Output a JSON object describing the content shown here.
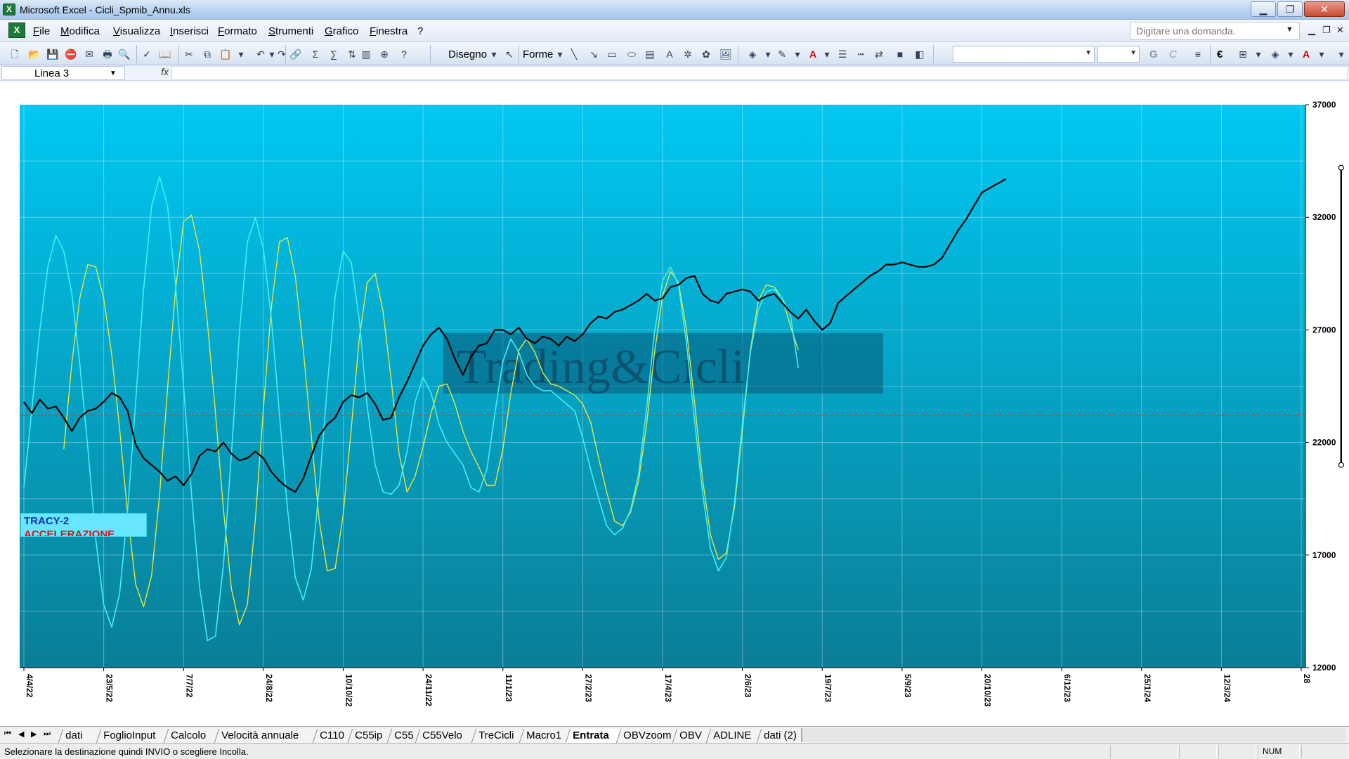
{
  "window": {
    "title": "Microsoft Excel - Cicli_Spmib_Annu.xls"
  },
  "menu": {
    "items": [
      "File",
      "Modifica",
      "Visualizza",
      "Inserisci",
      "Formato",
      "Strumenti",
      "Grafico",
      "Finestra",
      "?"
    ],
    "help_placeholder": "Digitare una domanda."
  },
  "toolbar": {
    "drawing_label": "Disegno",
    "shapes_label": "Forme",
    "font_bold": "G",
    "font_italic": "C",
    "currency_symbol": "€"
  },
  "formula_bar": {
    "name_box": "Linea 3",
    "fx": "fx"
  },
  "chart_data": {
    "type": "line",
    "watermark": "Trading&Cicli",
    "legend_title": "TRACY-2",
    "legend_subtitle": "ACCELERAZIONE",
    "y_ticks": [
      37000,
      32000,
      27000,
      22000,
      17000,
      12000
    ],
    "ylim": [
      12000,
      37000
    ],
    "x_tick_labels": [
      "4/4/22",
      "23/5/22",
      "7/7/22",
      "24/8/22",
      "10/10/22",
      "24/11/22",
      "11/1/23",
      "27/2/23",
      "17/4/23",
      "2/6/23",
      "19/7/23",
      "5/9/23",
      "20/10/23",
      "6/12/23",
      "25/1/24",
      "12/3/24",
      "28"
    ],
    "reference_level": 23200,
    "vertical_marker": {
      "x_index": 165,
      "y_top": 34200,
      "y_bottom": 21000
    },
    "colors": {
      "price": "#000000",
      "fast_cycle": "#3ff0f0",
      "slow_cycle": "#e8e83a",
      "reference": "#ff3030",
      "background_top": "#00c8f2",
      "background_bottom": "#0a7e96"
    },
    "points_per_tick": 10,
    "series": [
      {
        "x_start": 0,
        "values": [
          23800,
          23300,
          23900,
          23500,
          23600,
          23100,
          22500,
          23100,
          23400,
          23500,
          23800,
          24200,
          24000,
          23400,
          21900,
          21300,
          21000,
          20700,
          20300,
          20500,
          20100,
          20600,
          21400,
          21700,
          21600,
          22000,
          21500,
          21200,
          21300,
          21600,
          21300,
          20700,
          20300,
          20000,
          19800,
          20400,
          21400,
          22300,
          22800,
          23100,
          23800,
          24100,
          24000,
          24200,
          23700,
          23000,
          23100,
          24000,
          24700,
          25500,
          26300,
          26800,
          27100,
          26600,
          25700,
          25000,
          25800,
          26300,
          26400,
          27000,
          27000,
          26800,
          27100,
          26600,
          26400,
          26700,
          26600,
          26300,
          26700,
          26500,
          26800,
          27300,
          27600,
          27500,
          27800,
          27900,
          28100,
          28300,
          28600,
          28300,
          28400,
          28900,
          29000,
          29300,
          29400,
          28600,
          28300,
          28200,
          28600,
          28700,
          28800,
          28700,
          28300,
          28500,
          28600,
          28200,
          27800,
          27500,
          27900,
          27400,
          27000,
          27300,
          28200,
          28500,
          28800,
          29100,
          29400,
          29600,
          29900,
          29900,
          30000,
          29900,
          29800,
          29800,
          29900,
          30200,
          30800,
          31400,
          31900,
          32500,
          33100,
          33300,
          33500,
          33700
        ]
      },
      {
        "x_start": 0,
        "values": [
          20000,
          23500,
          27000,
          29800,
          31200,
          30500,
          28600,
          25500,
          21800,
          17700,
          14800,
          13800,
          15300,
          19000,
          23800,
          28800,
          32500,
          33800,
          32500,
          29000,
          24500,
          19700,
          15600,
          13200,
          13400,
          16600,
          21500,
          26900,
          30900,
          32000,
          30600,
          27500,
          23300,
          19100,
          16000,
          15000,
          16400,
          20000,
          24500,
          28500,
          30500,
          30000,
          27500,
          23600,
          21000,
          19800,
          19700,
          20100,
          21600,
          23800,
          24900,
          24200,
          22800,
          22000,
          21500,
          21000,
          20000,
          19800,
          20800,
          23300,
          25600,
          26600,
          26000,
          25000,
          24500,
          24300,
          24300,
          24000,
          23700,
          23400,
          22200,
          20800,
          19500,
          18300,
          17900,
          18200,
          19000,
          20600,
          23500,
          26900,
          29200,
          29800,
          29000,
          26400,
          23000,
          19800,
          17300,
          16300,
          16900,
          19300,
          22800,
          26000,
          27900,
          28700,
          28800,
          28400,
          27700,
          25300
        ]
      },
      {
        "x_start": 5,
        "values": [
          21700,
          25500,
          28400,
          29900,
          29800,
          28400,
          25900,
          22600,
          18800,
          15700,
          14700,
          16100,
          19700,
          24400,
          28800,
          31800,
          32100,
          30500,
          27300,
          23300,
          19000,
          15500,
          13900,
          14800,
          18600,
          23500,
          28000,
          30900,
          31100,
          29400,
          26100,
          22300,
          18500,
          16300,
          16400,
          18800,
          22600,
          26600,
          29100,
          29500,
          27800,
          24800,
          21500,
          19800,
          20500,
          21800,
          23300,
          24500,
          24600,
          23700,
          22500,
          21600,
          20900,
          20100,
          20100,
          21700,
          24200,
          26100,
          26600,
          26000,
          25100,
          24600,
          24500,
          24300,
          24100,
          23700,
          22900,
          21300,
          19800,
          18500,
          18300,
          18900,
          20300,
          22800,
          26000,
          28500,
          29600,
          29100,
          27000,
          23800,
          20400,
          17900,
          16800,
          17100,
          19100,
          22500,
          26100,
          28300,
          29000,
          28900,
          28400,
          27200,
          26100
        ]
      }
    ]
  },
  "sheet_tabs": {
    "items": [
      "dati",
      "FoglioInput",
      "Calcolo",
      "Velocità annuale",
      "C110",
      "C55ip",
      "C55",
      "C55Velo",
      "TreCicli",
      "Macro1",
      "Entrata",
      "OBVzoom",
      "OBV",
      "ADLINE",
      "dati (2)"
    ],
    "active": "Entrata"
  },
  "status": {
    "message": "Selezionare la destinazione quindi INVIO o scegliere Incolla.",
    "num_indicator": "NUM"
  }
}
